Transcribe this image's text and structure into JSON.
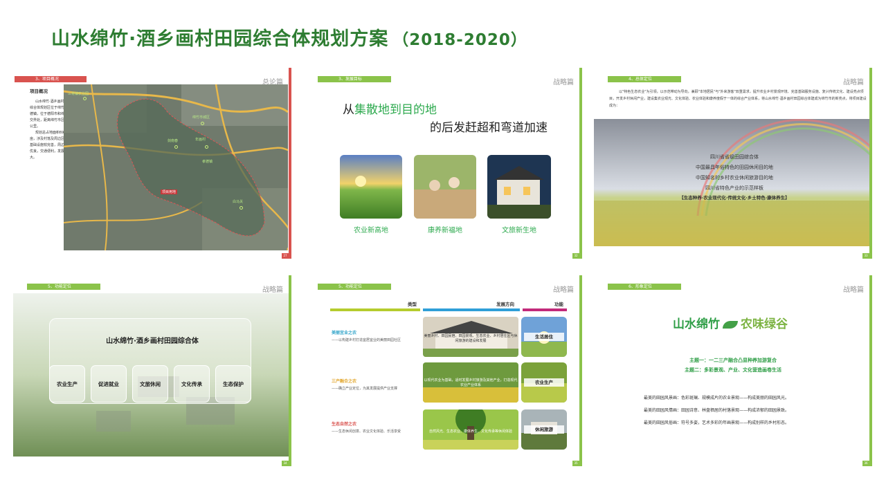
{
  "page": {
    "title": "山水绵竹·酒乡画村田园综合体规划方案",
    "years": "（2018-2020）"
  },
  "colors": {
    "green": "#2e7d32",
    "accent_green": "#8bc34a",
    "red": "#c8383a"
  },
  "slides": [
    {
      "tag": "3、项目概况",
      "section": "总论篇",
      "page_no": "27",
      "side_title": "项目概况",
      "side_text": [
        "山水绵竹·酒乡画村田园综合体规划区位于绵竹市孝德镇，位于德阳市和绵竹市交界处，距离绵竹市区约3公里。",
        "规划总占地面积6900亩，涉及村落及周边区域，基础设施较完善，周边环境优良，交通便利，发展潜力大。"
      ],
      "map_labels": [
        "三将镇农业园",
        "绵竹市城区",
        "剑南春",
        "年画村",
        "孝德镇",
        "白马关",
        "项目用地"
      ]
    },
    {
      "tag": "3、发展目标",
      "section": "战略篇",
      "page_no": "32",
      "headline_pre": "从",
      "headline_em": "集散地到目的地",
      "subline": "的后发赶超和弯道加速",
      "photos": [
        "农业新高地",
        "康养新福地",
        "文旅新生地"
      ]
    },
    {
      "tag": "4、总体定位",
      "section": "战略篇",
      "page_no": "33",
      "intro": "以\"特色生态农业\"为引领，以示范带动为导向，兼顾\"本地居民\"与\"外来游客\"双重需求，提升农业乡村景观环境、完善基础服务设施、复兴传统文化、建设亮点项目，开发乡村休闲产业，建设集农业观光、文化体验、农业体验和康养度假于一体的综合产业体系，将山水绵竹·酒乡画村田园综合体建成为绵竹市的新亮点，将项目建设成为：",
      "lines": [
        "四川省省级田园综合体",
        "中国最具年俗特色的田园休闲目的地",
        "中国知名的乡村农业休闲旅游目的地",
        "四川省特色产业的示范样板"
      ],
      "keywords": "【生态种养·农业现代化·传统文化·乡土特色·康体养生】"
    },
    {
      "tag": "5、功能定位",
      "section": "战略篇",
      "page_no": "34",
      "panel_title": "山水绵竹·酒乡画村田园综合体",
      "functions": [
        "农业生产",
        "促进就业",
        "文旅休闲",
        "文化传承",
        "生态保护"
      ]
    },
    {
      "tag": "5、功能定位",
      "section": "战略篇",
      "page_no": "35",
      "headers": [
        "类型",
        "发展方向",
        "功能"
      ],
      "rows": [
        {
          "type": "美丽宜业之农",
          "desc": "——以构建乡村打造宜居宜业的美丽田园社区",
          "direction": "美丽乡村、田园民宿、田园景观、生态农业、乡村居住区与休闲旅游的建设和发展",
          "function": "生活居住"
        },
        {
          "type": "三产融合之农",
          "desc": "——确立产业定位，为其发展提供产业支撑",
          "direction": "以现代农业为基础，适时发展乡村旅游及其他产业，打造现代农业产业体系",
          "function": "农业生产"
        },
        {
          "type": "生态自然之农",
          "desc": "——生态休闲创意、农业文化体验、乐活享受",
          "direction": "自然风光、生态农业、康体养生、文化传承等休闲体验",
          "function": "休闲旅游"
        }
      ]
    },
    {
      "tag": "6、形象定位",
      "section": "战略篇",
      "page_no": "36",
      "logo_left": "山水绵竹",
      "logo_right": "农味绿谷",
      "theme1": "主题一：一二三产融合凸显种养加游复合",
      "theme2": "主题二：多彩景观、产业、文化营造画卷生活",
      "paragraphs": [
        "最美的田园风景画：色彩斑斓、规模成片的农业景观——构成美丽的田园风光。",
        "最美的田园风情画：田园诗意、林盘栖居的村落景观——构成浓郁的田园景致。",
        "最美的田园风俗画：符号多姿，艺术多彩的年画景观——构成别样的乡村形态。"
      ]
    }
  ]
}
